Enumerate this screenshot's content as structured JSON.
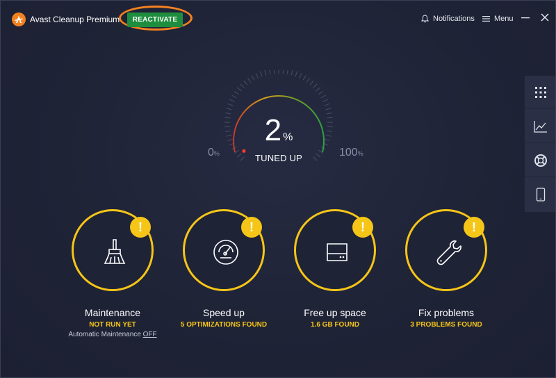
{
  "app": {
    "title": "Avast Cleanup Premium",
    "reactivate_label": "REACTIVATE",
    "accent_color": "#f48120",
    "reactivate_color": "#1e8e3e"
  },
  "titlebar": {
    "notifications_label": "Notifications",
    "notifications_icon": "bell-icon",
    "menu_label": "Menu",
    "menu_icon": "hamburger-icon"
  },
  "gauge": {
    "value": "2",
    "value_unit": "%",
    "label": "TUNED UP",
    "min": "0",
    "max": "100",
    "unit": "%",
    "fraction": 0.02
  },
  "sidepanel": {
    "icons": [
      "grid-icon",
      "chart-icon",
      "lifebuoy-icon",
      "mobile-icon"
    ]
  },
  "cards": [
    {
      "title": "Maintenance",
      "status": "NOT RUN YET",
      "sub_prefix": "Automatic Maintenance",
      "sub_link": "OFF",
      "icon": "broom-icon",
      "warning": "!"
    },
    {
      "title": "Speed up",
      "status": "5 OPTIMIZATIONS FOUND",
      "icon": "speedometer-icon",
      "warning": "!"
    },
    {
      "title": "Free up space",
      "status": "1.6 GB FOUND",
      "icon": "hard-drive-icon",
      "warning": "!"
    },
    {
      "title": "Fix problems",
      "status": "3 PROBLEMS FOUND",
      "icon": "wrench-icon",
      "warning": "!"
    }
  ],
  "colors": {
    "warning": "#f5c518",
    "background": "#1f2336"
  }
}
